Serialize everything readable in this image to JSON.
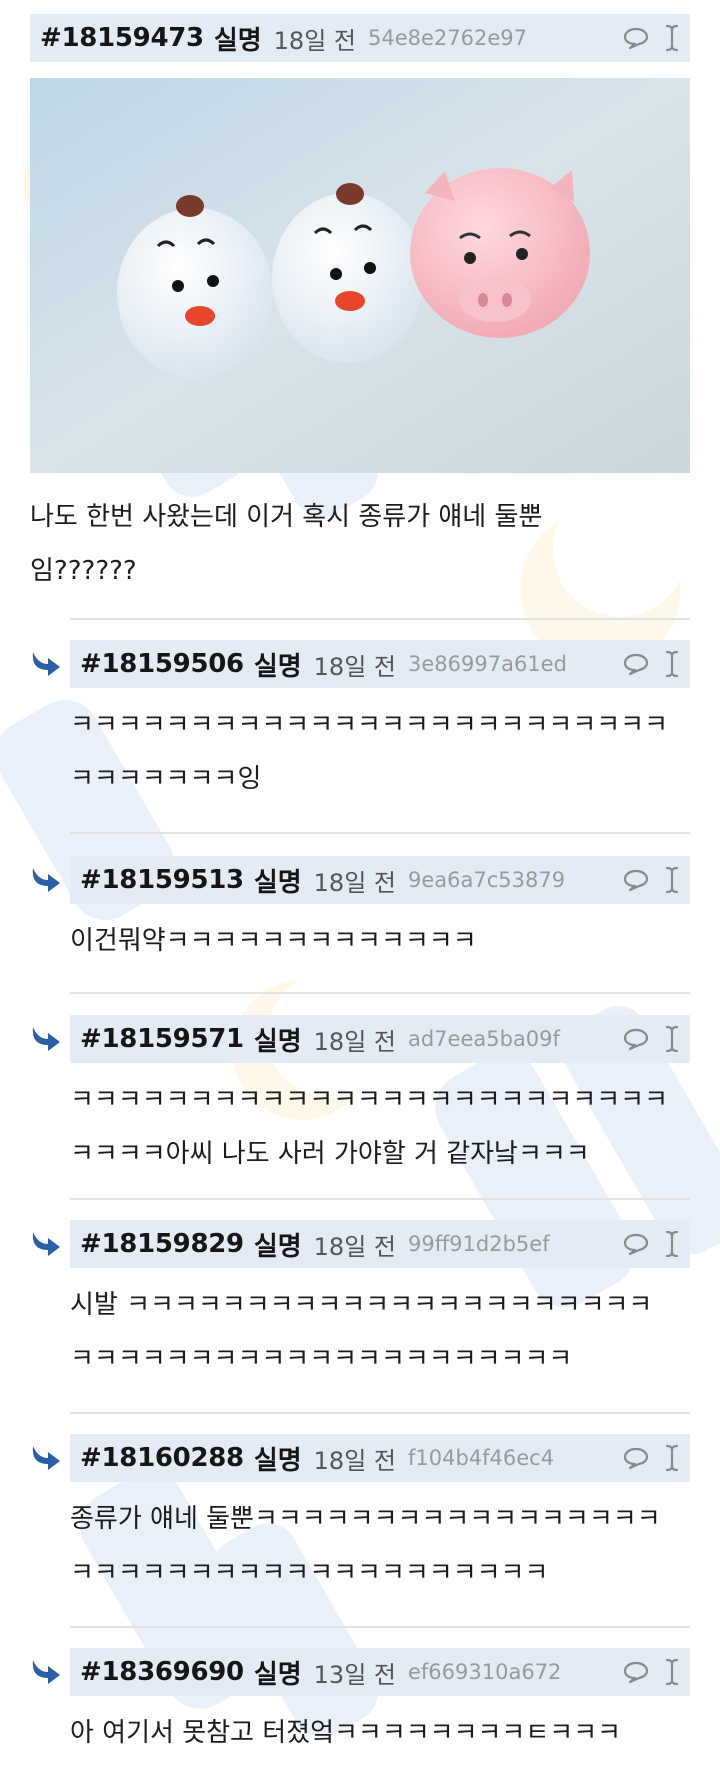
{
  "colors": {
    "header_bg": "#e3ebf5",
    "reply_arrow": "#2a5fa8",
    "icon_gray": "#8a8a8a",
    "divider": "#e2e2e2"
  },
  "post": {
    "number": "#18159473",
    "name": "실명",
    "time": "18일 전",
    "hash": "54e8e2762e97",
    "image_alt": "photo of three small toys: two white ones with red noses and one pink pig",
    "text": "나도 한번 사왔는데 이거 혹시 종류가 얘네 둘뿐\n임??????"
  },
  "icons": {
    "comment": "comment-bubble-icon",
    "cursor": "text-cursor-icon",
    "reply": "reply-arrow-icon"
  },
  "replies": [
    {
      "number": "#18159506",
      "name": "실명",
      "time": "18일 전",
      "hash": "3e86997a61ed",
      "text": "ㅋㅋㅋㅋㅋㅋㅋㅋㅋㅋㅋㅋㅋㅋㅋㅋㅋㅋㅋㅋㅋㅋㅋㅋㅋ\nㅋㅋㅋㅋㅋㅋㅋ잉"
    },
    {
      "number": "#18159513",
      "name": "실명",
      "time": "18일 전",
      "hash": "9ea6a7c53879",
      "text": "이건뭐약ㅋㅋㅋㅋㅋㅋㅋㅋㅋㅋㅋㅋㅋ"
    },
    {
      "number": "#18159571",
      "name": "실명",
      "time": "18일 전",
      "hash": "ad7eea5ba09f",
      "text": "ㅋㅋㅋㅋㅋㅋㅋㅋㅋㅋㅋㅋㅋㅋㅋㅋㅋㅋㅋㅋㅋㅋㅋㅋㅋ\nㅋㅋㅋㅋ아씨 나도 사러 가야할 거 같자낰ㅋㅋㅋ"
    },
    {
      "number": "#18159829",
      "name": "실명",
      "time": "18일 전",
      "hash": "99ff91d2b5ef",
      "text": "시발 ㅋㅋㅋㅋㅋㅋㅋㅋㅋㅋㅋㅋㅋㅋㅋㅋㅋㅋㅋㅋㅋㅋ\nㅋㅋㅋㅋㅋㅋㅋㅋㅋㅋㅋㅋㅋㅋㅋㅋㅋㅋㅋㅋㅋ"
    },
    {
      "number": "#18160288",
      "name": "실명",
      "time": "18일 전",
      "hash": "f104b4f46ec4",
      "text": "종류가 얘네 둘뿐ㅋㅋㅋㅋㅋㅋㅋㅋㅋㅋㅋㅋㅋㅋㅋㅋㅋ\nㅋㅋㅋㅋㅋㅋㅋㅋㅋㅋㅋㅋㅋㅋㅋㅋㅋㅋㅋㅋ"
    },
    {
      "number": "#18369690",
      "name": "실명",
      "time": "13일 전",
      "hash": "ef669310a672",
      "text": "아 여기서 못참고 터졌엌ㅋㅋㅋㅋㅋㅋㅋㅋㅌㅋㅋㅋ"
    }
  ]
}
